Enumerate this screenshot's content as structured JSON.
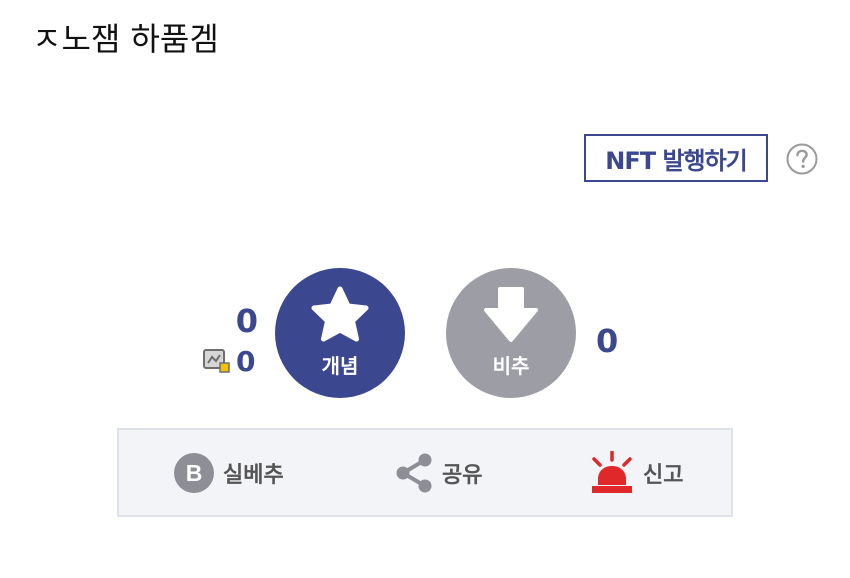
{
  "post": {
    "text": "ㅈ노잼 하품겜"
  },
  "nft": {
    "button_label": "NFT 발행하기",
    "help_icon": "question-circle-icon"
  },
  "votes": {
    "up_count": "0",
    "fixed_count": "0",
    "up_label": "개념",
    "down_label": "비추",
    "down_count": "0",
    "up_icon": "star-icon",
    "down_icon": "arrow-down-icon",
    "fixed_icon": "fixed-user-icon",
    "up_color": "#3b4890",
    "down_color": "#9d9da6"
  },
  "actions": {
    "best_label": "실베추",
    "share_label": "공유",
    "report_label": "신고",
    "best_icon": "b-circle-icon",
    "share_icon": "share-icon",
    "report_icon": "siren-icon",
    "report_color": "#e0282b"
  }
}
